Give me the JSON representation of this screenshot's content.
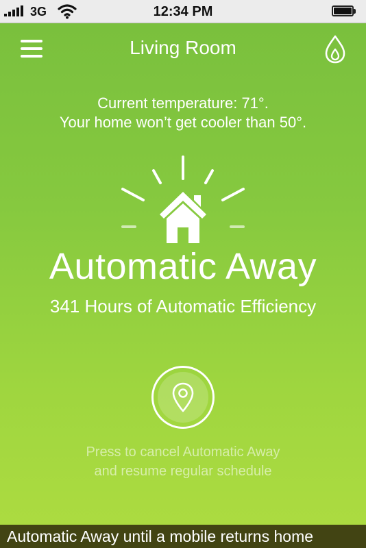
{
  "status_bar": {
    "carrier": "3G",
    "time": "12:34 PM",
    "icons": [
      "signal-icon",
      "wifi-icon",
      "battery-icon"
    ]
  },
  "header": {
    "title": "Living Room",
    "left_icon": "menu-icon",
    "right_icon": "flame-icon"
  },
  "info": {
    "current_temperature": "Current temperature: 71°.",
    "limit": "Your home won’t get cooler than 50°."
  },
  "mode": {
    "icon": "house-icon",
    "title": "Automatic Away",
    "efficiency": "341 Hours of Automatic Efficiency"
  },
  "cancel": {
    "icon": "location-pin-icon",
    "hint_line1": "Press to cancel Automatic Away",
    "hint_line2": "and resume regular schedule"
  },
  "footer": {
    "message": "Automatic Away until a mobile returns home"
  },
  "colors": {
    "background_top": "#7ac03d",
    "background_bottom": "#aedc41",
    "footer_bar": "#424413",
    "text": "#ffffff"
  }
}
